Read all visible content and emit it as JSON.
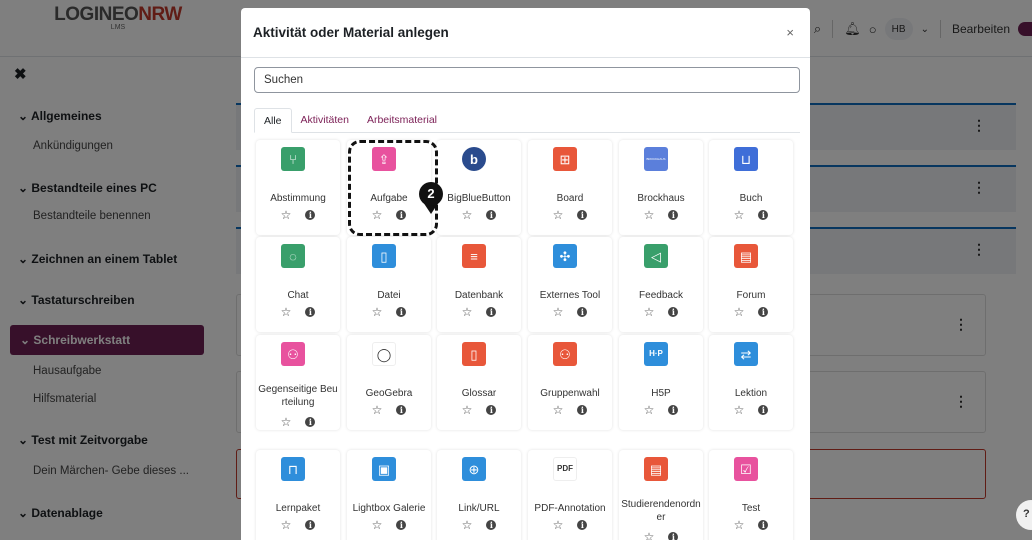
{
  "navbar": {
    "logo_main": "LOGINEO",
    "logo_accent": "NRW",
    "logo_sub": "LMS",
    "search_icon": "search-icon",
    "bell_icon": "bell-icon",
    "message_icon": "message-icon",
    "avatar_initials": "HB",
    "edit_label": "Bearbeiten",
    "accent_color": "#6e2054"
  },
  "drawer": {
    "sections": [
      {
        "label": "Allgemeines",
        "items": [
          "Ankündigungen"
        ]
      },
      {
        "label": "Bestandteile eines PC",
        "items": [
          "Bestandteile benennen"
        ]
      },
      {
        "label": "Zeichnen an einem Tablet",
        "items": []
      },
      {
        "label": "Tastaturschreiben",
        "items": []
      },
      {
        "label": "Schreibwerkstatt",
        "items": [
          "Hausaufgabe",
          "Hilfsmaterial"
        ],
        "active": true
      },
      {
        "label": "Test mit Zeitvorgabe",
        "items": [
          "Dein Märchen- Gebe dieses ..."
        ]
      },
      {
        "label": "Datenablage",
        "items": []
      }
    ]
  },
  "modal": {
    "title": "Aktivität oder Material anlegen",
    "close_label": "×",
    "search_placeholder": "Suchen",
    "tabs": [
      {
        "label": "Alle",
        "active": true
      },
      {
        "label": "Aktivitäten",
        "active": false
      },
      {
        "label": "Arbeitsmaterial",
        "active": false
      }
    ],
    "star_glyph": "☆",
    "info_glyph": "i",
    "modules": [
      {
        "name": "Abstimmung",
        "icon": "poll-icon",
        "glyph": "⑂",
        "color": "#399f6b"
      },
      {
        "name": "Aufgabe",
        "icon": "assignment-icon",
        "glyph": "⇪",
        "color": "#e8529e"
      },
      {
        "name": "BigBlueButton",
        "icon": "bigbluebutton-icon",
        "glyph": "b",
        "color": "#2a4b8d"
      },
      {
        "name": "Board",
        "icon": "board-icon",
        "glyph": "⊞",
        "color": "#e8573a"
      },
      {
        "name": "Brockhaus",
        "icon": "brockhaus-icon",
        "glyph": "BROCKHAUS",
        "color": "#5b7fdb"
      },
      {
        "name": "Buch",
        "icon": "book-icon",
        "glyph": "⊔",
        "color": "#3f6ed8"
      },
      {
        "name": "Chat",
        "icon": "chat-icon",
        "glyph": "◌",
        "color": "#399f6b"
      },
      {
        "name": "Datei",
        "icon": "file-icon",
        "glyph": "▯",
        "color": "#2e8edb"
      },
      {
        "name": "Datenbank",
        "icon": "database-icon",
        "glyph": "≡",
        "color": "#e8573a"
      },
      {
        "name": "Externes Tool",
        "icon": "external-tool-icon",
        "glyph": "✣",
        "color": "#2e8edb"
      },
      {
        "name": "Feedback",
        "icon": "feedback-icon",
        "glyph": "◁",
        "color": "#399f6b"
      },
      {
        "name": "Forum",
        "icon": "forum-icon",
        "glyph": "▤",
        "color": "#e8573a"
      },
      {
        "name": "Gegenseitige Beurteilung",
        "icon": "workshop-icon",
        "glyph": "⚇",
        "color": "#e8529e"
      },
      {
        "name": "GeoGebra",
        "icon": "geogebra-icon",
        "glyph": "◯",
        "color": "#ffffff"
      },
      {
        "name": "Glossar",
        "icon": "glossary-icon",
        "glyph": "▯",
        "color": "#e8573a"
      },
      {
        "name": "Gruppenwahl",
        "icon": "group-choice-icon",
        "glyph": "⚇",
        "color": "#e8573a"
      },
      {
        "name": "H5P",
        "icon": "h5p-icon",
        "glyph": "H·P",
        "color": "#2e8edb"
      },
      {
        "name": "Lektion",
        "icon": "lesson-icon",
        "glyph": "⇄",
        "color": "#2e8edb"
      },
      {
        "name": "Lernpaket",
        "icon": "package-icon",
        "glyph": "⊓",
        "color": "#2e8edb"
      },
      {
        "name": "Lightbox Galerie",
        "icon": "gallery-icon",
        "glyph": "▣",
        "color": "#2e8edb"
      },
      {
        "name": "Link/URL",
        "icon": "url-icon",
        "glyph": "⊕",
        "color": "#2e8edb"
      },
      {
        "name": "PDF-Annotation",
        "icon": "pdf-annotation-icon",
        "glyph": "PDF",
        "color": "#ffffff"
      },
      {
        "name": "Studierendenordner",
        "icon": "student-folder-icon",
        "glyph": "▤",
        "color": "#e8573a"
      },
      {
        "name": "Test",
        "icon": "quiz-icon",
        "glyph": "☑",
        "color": "#e8529e"
      }
    ]
  },
  "annotation": {
    "step_number": "2"
  },
  "help_button_label": "?"
}
